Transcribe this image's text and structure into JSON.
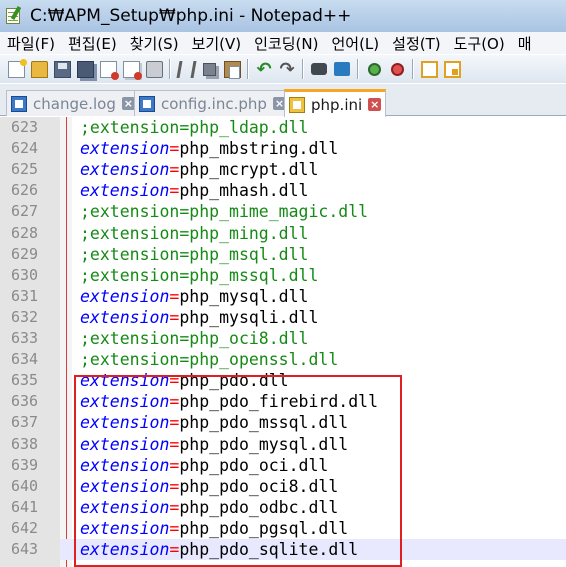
{
  "window": {
    "title": "C:₩APM_Setup₩php.ini - Notepad++"
  },
  "menu": [
    "파일(F)",
    "편집(E)",
    "찾기(S)",
    "보기(V)",
    "인코딩(N)",
    "언어(L)",
    "설정(T)",
    "도구(O)",
    "매"
  ],
  "toolbar": {
    "buttons": [
      "new-file-icon",
      "open-file-icon",
      "save-icon",
      "save-all-icon",
      "close-icon",
      "close-all-icon",
      "print-icon",
      "cut-icon",
      "copy-icon",
      "paste-icon",
      "undo-icon",
      "redo-icon",
      "find-icon",
      "replace-icon",
      "zoom-in-icon",
      "zoom-out-icon",
      "word-wrap-icon",
      "sync-scroll-icon"
    ]
  },
  "tabs": [
    {
      "label": "change.log",
      "active": false
    },
    {
      "label": "config.inc.php",
      "active": false
    },
    {
      "label": "php.ini",
      "active": true
    }
  ],
  "editor": {
    "current_line": 643,
    "highlight_color": "#e02020",
    "lines": [
      {
        "num": "623",
        "commented": true,
        "key": "extension",
        "op": "=",
        "value": "php_ldap.dll"
      },
      {
        "num": "624",
        "commented": false,
        "key": "extension",
        "op": "=",
        "value": "php_mbstring.dll"
      },
      {
        "num": "625",
        "commented": false,
        "key": "extension",
        "op": "=",
        "value": "php_mcrypt.dll"
      },
      {
        "num": "626",
        "commented": false,
        "key": "extension",
        "op": "=",
        "value": "php_mhash.dll"
      },
      {
        "num": "627",
        "commented": true,
        "key": "extension",
        "op": "=",
        "value": "php_mime_magic.dll"
      },
      {
        "num": "628",
        "commented": true,
        "key": "extension",
        "op": "=",
        "value": "php_ming.dll"
      },
      {
        "num": "629",
        "commented": true,
        "key": "extension",
        "op": "=",
        "value": "php_msql.dll"
      },
      {
        "num": "630",
        "commented": true,
        "key": "extension",
        "op": "=",
        "value": "php_mssql.dll"
      },
      {
        "num": "631",
        "commented": false,
        "key": "extension",
        "op": "=",
        "value": "php_mysql.dll"
      },
      {
        "num": "632",
        "commented": false,
        "key": "extension",
        "op": "=",
        "value": "php_mysqli.dll"
      },
      {
        "num": "633",
        "commented": true,
        "key": "extension",
        "op": "=",
        "value": "php_oci8.dll"
      },
      {
        "num": "634",
        "commented": true,
        "key": "extension",
        "op": "=",
        "value": "php_openssl.dll"
      },
      {
        "num": "635",
        "commented": false,
        "key": "extension",
        "op": "=",
        "value": "php_pdo.dll"
      },
      {
        "num": "636",
        "commented": false,
        "key": "extension",
        "op": "=",
        "value": "php_pdo_firebird.dll"
      },
      {
        "num": "637",
        "commented": false,
        "key": "extension",
        "op": "=",
        "value": "php_pdo_mssql.dll"
      },
      {
        "num": "638",
        "commented": false,
        "key": "extension",
        "op": "=",
        "value": "php_pdo_mysql.dll"
      },
      {
        "num": "639",
        "commented": false,
        "key": "extension",
        "op": "=",
        "value": "php_pdo_oci.dll"
      },
      {
        "num": "640",
        "commented": false,
        "key": "extension",
        "op": "=",
        "value": "php_pdo_oci8.dll"
      },
      {
        "num": "641",
        "commented": false,
        "key": "extension",
        "op": "=",
        "value": "php_pdo_odbc.dll"
      },
      {
        "num": "642",
        "commented": false,
        "key": "extension",
        "op": "=",
        "value": "php_pdo_pgsql.dll"
      },
      {
        "num": "643",
        "commented": false,
        "key": "extension",
        "op": "=",
        "value": "php_pdo_sqlite.dll"
      }
    ]
  }
}
